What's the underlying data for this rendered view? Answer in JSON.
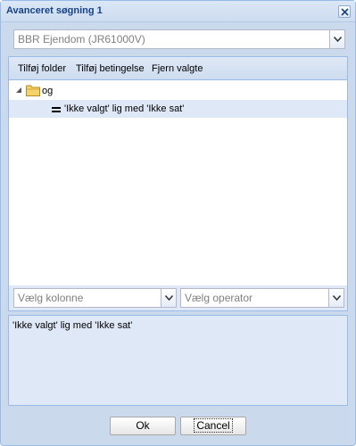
{
  "window": {
    "title": "Avanceret søgning 1"
  },
  "table_select": {
    "value": "BBR Ejendom (JR61000V)"
  },
  "toolbar": {
    "add_folder": "Tilføj folder",
    "add_condition": "Tilføj betingelse",
    "remove_selected": "Fjern valgte"
  },
  "tree": {
    "root_label": "og",
    "condition_label": "'Ikke valgt' lig med 'Ikke sat'"
  },
  "column_select": {
    "placeholder": "Vælg kolonne"
  },
  "operator_select": {
    "placeholder": "Vælg operator"
  },
  "details": {
    "text": "'Ikke valgt' lig med 'Ikke sat'"
  },
  "footer": {
    "ok_label": "Ok",
    "cancel_label": "Cancel"
  },
  "colors": {
    "title_text": "#15428b",
    "border": "#99bbe8",
    "selected_row": "#dfe8f6",
    "folder": "#f5d36b"
  }
}
